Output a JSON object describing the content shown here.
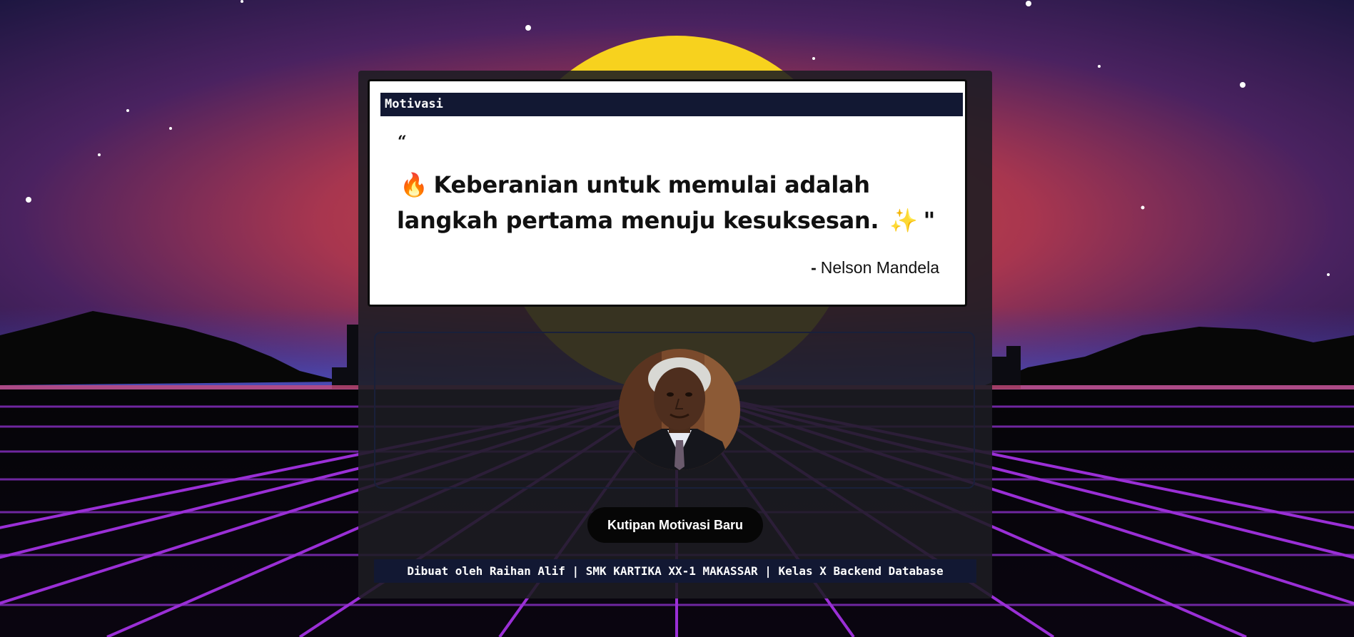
{
  "header": {
    "label": "Motivasi"
  },
  "quote": {
    "open_mark": "“",
    "emoji_start": "🔥",
    "text": "Keberanian untuk memulai adalah langkah pertama menuju kesuksesan.",
    "emoji_end": "✨",
    "close_mark": "\"",
    "author_dash": "-",
    "author": "Nelson Mandela"
  },
  "actions": {
    "new_quote_label": "Kutipan Motivasi Baru"
  },
  "footer": {
    "credit": "Dibuat oleh Raihan Alif | SMK KARTIKA XX-1 MAKASSAR | Kelas X Backend Database"
  },
  "colors": {
    "header_bg": "#121833",
    "button_bg": "#060606",
    "sun": "#f7d21e",
    "grid": "#9a2fd6"
  }
}
